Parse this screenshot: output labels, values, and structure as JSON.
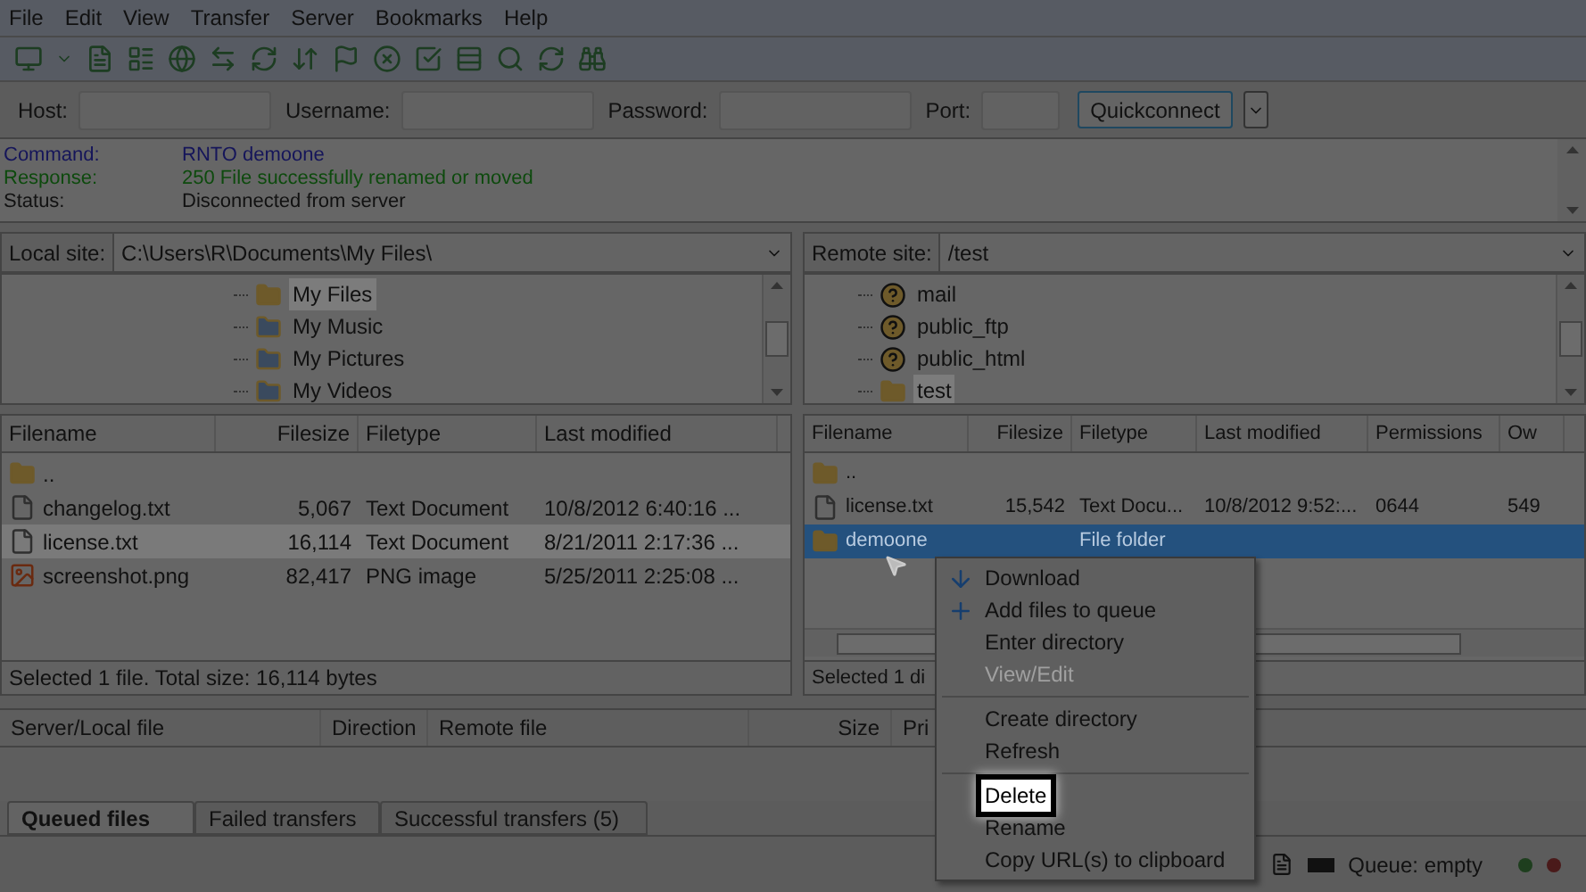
{
  "menu_bar": [
    "File",
    "Edit",
    "View",
    "Transfer",
    "Server",
    "Bookmarks",
    "Help"
  ],
  "quickconnect": {
    "fields": [
      {
        "label": "Host:"
      },
      {
        "label": "Username:"
      },
      {
        "label": "Password:"
      },
      {
        "label": "Port:"
      }
    ],
    "button": "Quickconnect"
  },
  "message_log": [
    {
      "label": "Command:",
      "text": "RNTO demoone",
      "kind": "command"
    },
    {
      "label": "Response:",
      "text": "250 File successfully renamed or moved",
      "kind": "response"
    },
    {
      "label": "Status:",
      "text": "Disconnected from server",
      "kind": "status"
    }
  ],
  "local": {
    "site_label": "Local site:",
    "path": "C:\\Users\\R\\Documents\\My Files\\",
    "tree": [
      {
        "name": "My Files",
        "kind": "folder",
        "selected": true
      },
      {
        "name": "My Music",
        "kind": "music",
        "selected": false
      },
      {
        "name": "My Pictures",
        "kind": "pictures",
        "selected": false
      },
      {
        "name": "My Videos",
        "kind": "videos",
        "selected": false
      }
    ],
    "columns": [
      "Filename",
      "Filesize",
      "Filetype",
      "Last modified"
    ],
    "rows": [
      {
        "kind": "folder",
        "name": "..",
        "selected": false
      },
      {
        "kind": "text",
        "name": "changelog.txt",
        "size": "5,067",
        "type": "Text Document",
        "modified": "10/8/2012 6:40:16 ...",
        "selected": false
      },
      {
        "kind": "text",
        "name": "license.txt",
        "size": "16,114",
        "type": "Text Document",
        "modified": "8/21/2011 2:17:36 ...",
        "selected": true
      },
      {
        "kind": "image",
        "name": "screenshot.png",
        "size": "82,417",
        "type": "PNG image",
        "modified": "5/25/2011 2:25:08 ...",
        "selected": false
      }
    ],
    "status": "Selected 1 file. Total size: 16,114 bytes"
  },
  "remote": {
    "site_label": "Remote site:",
    "path": "/test",
    "tree": [
      {
        "name": "mail",
        "kind": "unknown",
        "selected": false
      },
      {
        "name": "public_ftp",
        "kind": "unknown",
        "selected": false
      },
      {
        "name": "public_html",
        "kind": "unknown",
        "selected": false
      },
      {
        "name": "test",
        "kind": "folder",
        "selected": true
      }
    ],
    "columns": [
      "Filename",
      "Filesize",
      "Filetype",
      "Last modified",
      "Permissions",
      "Ow"
    ],
    "rows": [
      {
        "kind": "folder",
        "name": "..",
        "selected": false
      },
      {
        "kind": "text",
        "name": "license.txt",
        "size": "15,542",
        "type": "Text Docu...",
        "modified": "10/8/2012 9:52:...",
        "permissions": "0644",
        "column_6": "549",
        "selected": false
      },
      {
        "kind": "folder",
        "name": "demoone",
        "type": "File folder",
        "selected": true
      }
    ],
    "status": "Selected 1 di"
  },
  "context_menu": [
    {
      "kind": "download",
      "label": "Download",
      "disabled": false,
      "selected": false
    },
    {
      "kind": "add",
      "label": "Add files to queue",
      "disabled": false,
      "selected": false
    },
    {
      "kind": "item",
      "label": "Enter directory",
      "disabled": false,
      "selected": false
    },
    {
      "kind": "item",
      "label": "View/Edit",
      "disabled": true,
      "selected": false
    },
    {
      "kind": "separator"
    },
    {
      "kind": "item",
      "label": "Create directory",
      "disabled": false,
      "selected": false
    },
    {
      "kind": "item",
      "label": "Refresh",
      "disabled": false,
      "selected": false
    },
    {
      "kind": "separator"
    },
    {
      "kind": "item",
      "label": "Delete",
      "disabled": false,
      "selected": true
    },
    {
      "kind": "item",
      "label": "Rename",
      "disabled": false,
      "selected": false
    },
    {
      "kind": "item",
      "label": "Copy URL(s) to clipboard",
      "disabled": false,
      "selected": false
    }
  ],
  "queue": {
    "columns": [
      "Server/Local file",
      "Direction",
      "Remote file",
      "Size",
      "Pri"
    ],
    "tabs": [
      {
        "label": "Queued files",
        "selected": true
      },
      {
        "label": "Failed transfers",
        "selected": false
      },
      {
        "label": "Successful transfers (5)",
        "selected": false
      }
    ],
    "status": "Queue: empty"
  }
}
